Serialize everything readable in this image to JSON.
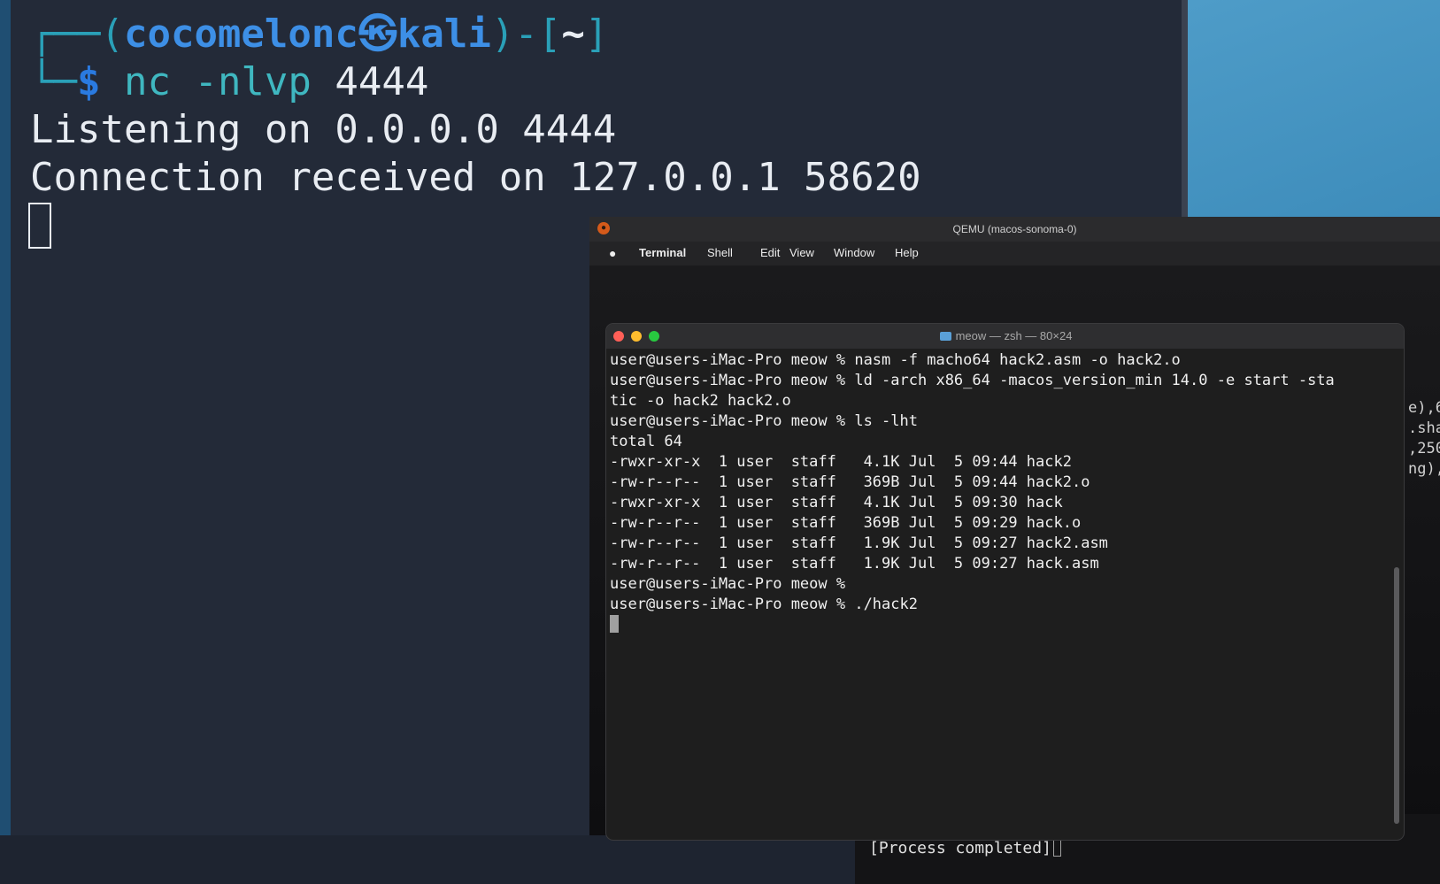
{
  "kali": {
    "prompt_open": "┌──(",
    "user": "cocomelonc",
    "skull": "㉿",
    "host": "kali",
    "prompt_mid": ")-[",
    "dir": "~",
    "prompt_close": "]",
    "corner": "└─",
    "dollar": "$",
    "cmd": "nc -nlvp",
    "arg": "4444",
    "output": [
      "Listening on 0.0.0.0 4444",
      "Connection received on 127.0.0.1 58620"
    ]
  },
  "qemu": {
    "title": "QEMU (macos-sonoma-0)"
  },
  "menubar": {
    "apple": "",
    "items": [
      "Terminal",
      "Shell",
      "Edit",
      "View",
      "Window",
      "Help"
    ]
  },
  "terminal": {
    "title": "meow — zsh — 80×24",
    "lines": [
      "user@users-iMac-Pro meow % nasm -f macho64 hack2.asm -o hack2.o",
      "user@users-iMac-Pro meow % ld -arch x86_64 -macos_version_min 14.0 -e start -sta",
      "tic -o hack2 hack2.o",
      "user@users-iMac-Pro meow % ls -lht",
      "total 64",
      "-rwxr-xr-x  1 user  staff   4.1K Jul  5 09:44 hack2",
      "-rw-r--r--  1 user  staff   369B Jul  5 09:44 hack2.o",
      "-rwxr-xr-x  1 user  staff   4.1K Jul  5 09:30 hack",
      "-rw-r--r--  1 user  staff   369B Jul  5 09:29 hack.o",
      "-rw-r--r--  1 user  staff   1.9K Jul  5 09:27 hack2.asm",
      "-rw-r--r--  1 user  staff   1.9K Jul  5 09:27 hack.asm",
      "user@users-iMac-Pro meow %",
      "user@users-iMac-Pro meow % ./hack2"
    ]
  },
  "behind_window_text": [
    "e),6",
    ".sha",
    ",250",
    "ng),"
  ],
  "process_status": "[Process completed]"
}
